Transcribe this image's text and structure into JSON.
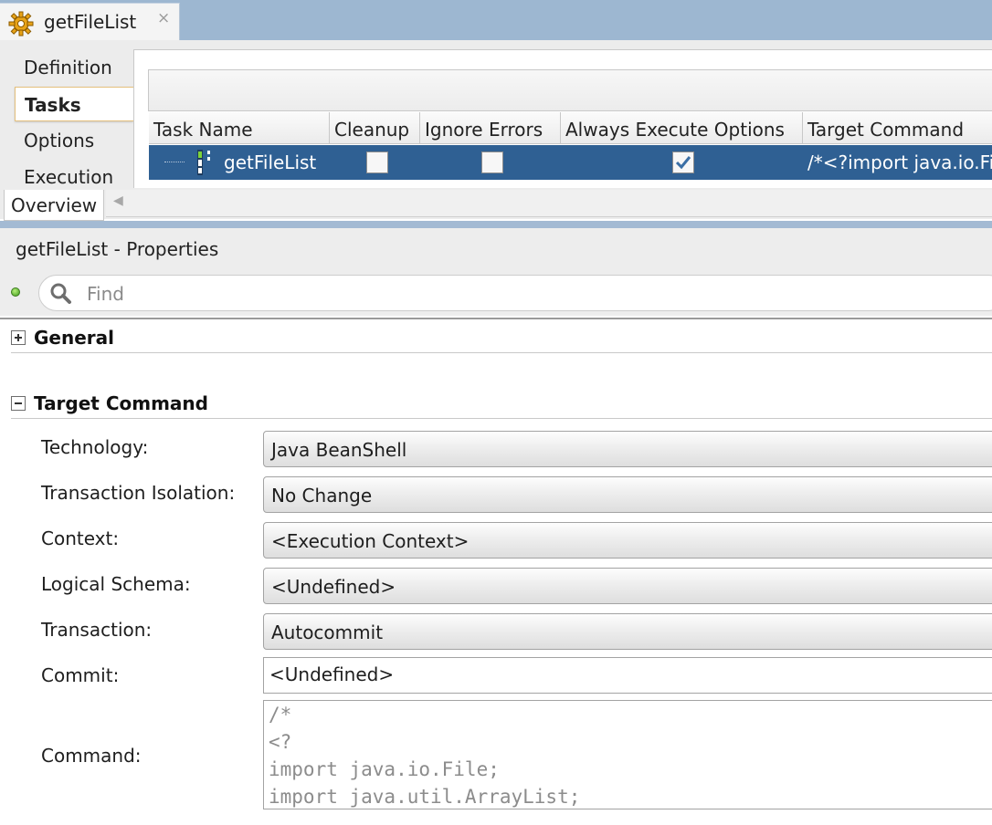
{
  "editor_tab": {
    "title": "getFileList",
    "close": "×"
  },
  "vertical_tabs": [
    {
      "label": "Definition"
    },
    {
      "label": "Tasks"
    },
    {
      "label": "Options"
    },
    {
      "label": "Execution"
    }
  ],
  "overview_tab": "Overview",
  "tasks_table": {
    "columns": [
      "Task Name",
      "Cleanup",
      "Ignore Errors",
      "Always Execute Options",
      "Target Command"
    ],
    "rows": [
      {
        "task_name": "getFileList",
        "cleanup": false,
        "ignore_errors": false,
        "always_execute_options": true,
        "target_command": "/*<?import java.io.File;"
      }
    ]
  },
  "properties": {
    "title": "getFileList - Properties",
    "search_placeholder": "Find",
    "sections": {
      "general": {
        "title": "General",
        "expanded": false
      },
      "target_command": {
        "title": "Target Command",
        "expanded": true
      }
    },
    "fields": {
      "technology": {
        "label": "Technology:",
        "value": "Java BeanShell"
      },
      "transaction_isolation": {
        "label": "Transaction Isolation:",
        "value": "No Change"
      },
      "context": {
        "label": "Context:",
        "value": "<Execution Context>"
      },
      "logical_schema": {
        "label": "Logical Schema:",
        "value": "<Undefined>"
      },
      "transaction": {
        "label": "Transaction:",
        "value": "Autocommit"
      },
      "commit": {
        "label": "Commit:",
        "value": "<Undefined>"
      },
      "command": {
        "label": "Command:",
        "lines": [
          "/*",
          "<?",
          "import java.io.File;",
          "import java.util.ArrayList;"
        ]
      }
    }
  },
  "colors": {
    "tab_strip": "#9db7d1",
    "selected_row": "#2f6093",
    "active_tab_border": "#e4c07d"
  }
}
